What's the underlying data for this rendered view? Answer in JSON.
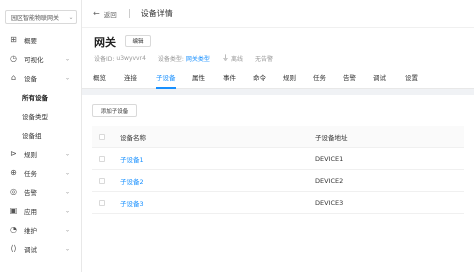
{
  "sidebar": {
    "project": "园区智能物联网关",
    "items": [
      {
        "label": "概要",
        "icon": "dashboard-icon",
        "glyph": "⊞",
        "arrow": false
      },
      {
        "label": "可视化",
        "icon": "visual-icon",
        "glyph": "◷",
        "arrow": true
      },
      {
        "label": "设备",
        "icon": "device-icon",
        "glyph": "⌂",
        "arrow": true
      }
    ],
    "sub_items": [
      {
        "label": "所有设备",
        "active": true
      },
      {
        "label": "设备类型",
        "active": false
      },
      {
        "label": "设备组",
        "active": false
      }
    ],
    "items_after": [
      {
        "label": "规则",
        "icon": "rule-icon",
        "glyph": "⊳",
        "arrow": true
      },
      {
        "label": "任务",
        "icon": "task-icon",
        "glyph": "⊕",
        "arrow": true
      },
      {
        "label": "告警",
        "icon": "alarm-icon",
        "glyph": "◎",
        "arrow": true
      },
      {
        "label": "应用",
        "icon": "app-icon",
        "glyph": "▣",
        "arrow": true
      },
      {
        "label": "维护",
        "icon": "maintain-icon",
        "glyph": "◔",
        "arrow": true
      },
      {
        "label": "调试",
        "icon": "debug-icon",
        "glyph": "⟨⟩",
        "arrow": true
      }
    ]
  },
  "topbar": {
    "back_label": "返回",
    "title": "设备详情"
  },
  "header": {
    "name": "网关",
    "edit_label": "编辑",
    "device_id_label": "设备ID:",
    "device_id": "u3wyvvr4",
    "device_type_label": "设备类型:",
    "device_type": "网关类型",
    "status": "离线",
    "alarm_status": "无告警"
  },
  "tabs": [
    {
      "label": "概览",
      "active": false
    },
    {
      "label": "连接",
      "active": false
    },
    {
      "label": "子设备",
      "active": true
    },
    {
      "label": "属性",
      "active": false
    },
    {
      "label": "事件",
      "active": false
    },
    {
      "label": "命令",
      "active": false
    },
    {
      "label": "规则",
      "active": false
    },
    {
      "label": "任务",
      "active": false
    },
    {
      "label": "告警",
      "active": false
    },
    {
      "label": "调试",
      "active": false
    },
    {
      "label": "设置",
      "active": false
    }
  ],
  "content": {
    "add_button": "添加子设备",
    "columns": [
      "设备名称",
      "子设备地址"
    ],
    "rows": [
      {
        "name": "子设备1",
        "address": "DEVICE1"
      },
      {
        "name": "子设备2",
        "address": "DEVICE2"
      },
      {
        "name": "子设备3",
        "address": "DEVICE3"
      }
    ]
  }
}
